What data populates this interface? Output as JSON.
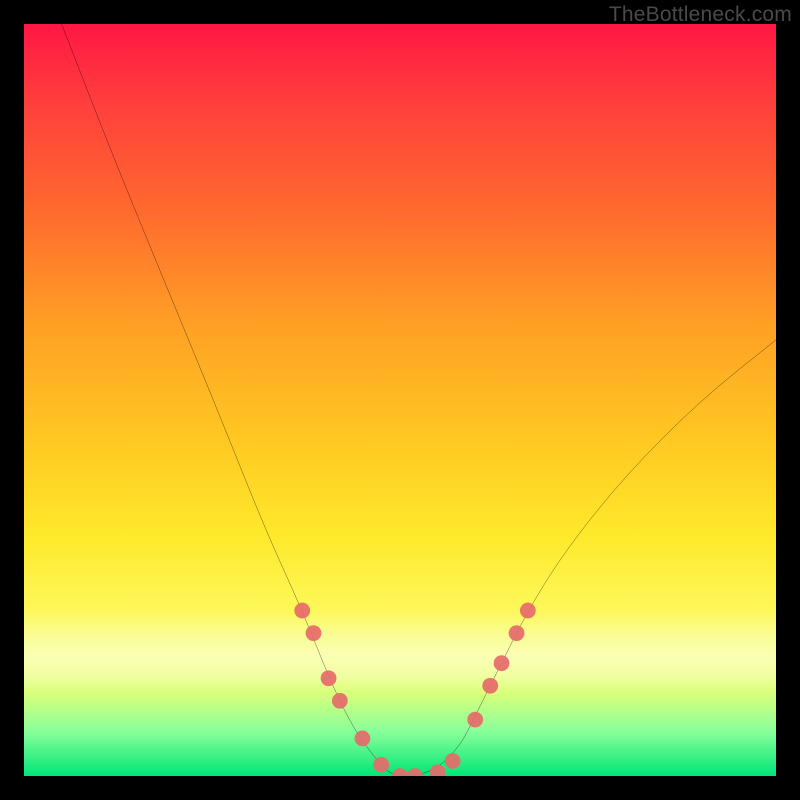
{
  "watermark": "TheBottleneck.com",
  "chart_data": {
    "type": "line",
    "title": "",
    "xlabel": "",
    "ylabel": "",
    "xlim": [
      0,
      100
    ],
    "ylim": [
      0,
      100
    ],
    "grid": false,
    "series": [
      {
        "name": "bottleneck-curve",
        "x": [
          5,
          12,
          19,
          26,
          32,
          37,
          41,
          44,
          47,
          49,
          52,
          55,
          58,
          60,
          63,
          67,
          72,
          80,
          90,
          100
        ],
        "values": [
          100,
          82,
          65,
          48,
          33,
          22,
          12,
          6,
          2,
          0,
          0,
          1,
          4,
          8,
          14,
          22,
          30,
          40,
          50,
          58
        ]
      }
    ],
    "markers": {
      "name": "highlight-dots",
      "x": [
        37,
        38.5,
        40.5,
        42,
        45,
        47.5,
        50,
        52,
        55,
        57,
        60,
        62,
        63.5,
        65.5,
        67
      ],
      "values": [
        22,
        19,
        13,
        10,
        5,
        1.5,
        0,
        0,
        0.5,
        2,
        7.5,
        12,
        15,
        19,
        22
      ]
    }
  }
}
